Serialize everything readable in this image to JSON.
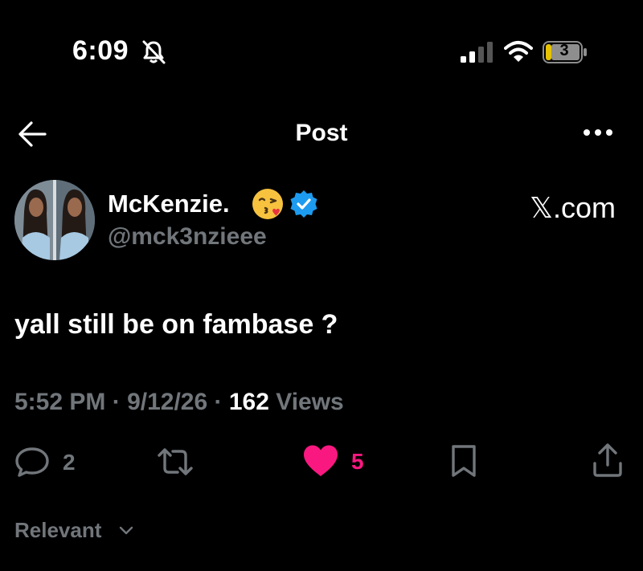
{
  "status_bar": {
    "time": "6:09",
    "battery": "3",
    "icons": [
      "bell-slash-icon",
      "signal-icon",
      "wifi-icon",
      "battery-icon"
    ]
  },
  "header": {
    "title": "Post",
    "icons": [
      "arrow-left-icon",
      "more-icon"
    ]
  },
  "author": {
    "name": "McKenzie.",
    "handle": "@mck3nzieee",
    "emoji": "kissing-face-emoji",
    "verified": true
  },
  "brand": "𝕏.com",
  "post": {
    "text": "yall still be on fambase ?",
    "time": "5:52 PM",
    "date": "9/12/26",
    "views_count": "162",
    "views_label": "Views"
  },
  "actions": {
    "reply_count": "2",
    "like_count": "5",
    "colors": {
      "muted": "#71767b",
      "like": "#f91880",
      "verified": "#1d9bf0"
    }
  },
  "sort": {
    "label": "Relevant"
  }
}
